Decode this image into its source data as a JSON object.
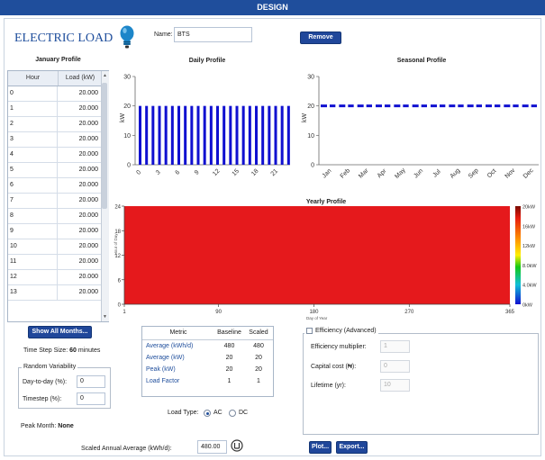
{
  "window": {
    "title": "DESIGN"
  },
  "header": {
    "app_title": "ELECTRIC LOAD",
    "name_label": "Name:",
    "name_value": "BTS",
    "remove_label": "Remove"
  },
  "january_profile": {
    "title": "January Profile",
    "col_hour": "Hour",
    "col_load": "Load (kW)",
    "rows": [
      {
        "hour": "0",
        "load": "20.000"
      },
      {
        "hour": "1",
        "load": "20.000"
      },
      {
        "hour": "2",
        "load": "20.000"
      },
      {
        "hour": "3",
        "load": "20.000"
      },
      {
        "hour": "4",
        "load": "20.000"
      },
      {
        "hour": "5",
        "load": "20.000"
      },
      {
        "hour": "6",
        "load": "20.000"
      },
      {
        "hour": "7",
        "load": "20.000"
      },
      {
        "hour": "8",
        "load": "20.000"
      },
      {
        "hour": "9",
        "load": "20.000"
      },
      {
        "hour": "10",
        "load": "20.000"
      },
      {
        "hour": "11",
        "load": "20.000"
      },
      {
        "hour": "12",
        "load": "20.000"
      },
      {
        "hour": "13",
        "load": "20.000"
      }
    ]
  },
  "show_all_months_label": "Show All Months...",
  "time_step": {
    "label": "Time Step Size:",
    "value": "60",
    "unit": "minutes"
  },
  "random_variability": {
    "title": "Random Variability",
    "day_to_day_label": "Day-to-day (%):",
    "day_to_day_value": "0",
    "timestep_label": "Timestep (%):",
    "timestep_value": "0"
  },
  "peak_month": {
    "label": "Peak Month:",
    "value": "None"
  },
  "scaled_annual": {
    "label": "Scaled Annual Average (kWh/d):",
    "value": "480.00"
  },
  "metrics": {
    "headers": [
      "Metric",
      "Baseline",
      "Scaled"
    ],
    "rows": [
      {
        "metric": "Average (kWh/d)",
        "baseline": "480",
        "scaled": "480"
      },
      {
        "metric": "Average (kW)",
        "baseline": "20",
        "scaled": "20"
      },
      {
        "metric": "Peak (kW)",
        "baseline": "20",
        "scaled": "20"
      },
      {
        "metric": "Load Factor",
        "baseline": "1",
        "scaled": "1"
      }
    ]
  },
  "load_type": {
    "label": "Load Type:",
    "options": [
      "AC",
      "DC"
    ],
    "selected": "AC"
  },
  "efficiency": {
    "title": "Efficiency (Advanced)",
    "checked": false,
    "multiplier_label": "Efficiency multiplier:",
    "multiplier_value": "1",
    "capital_label": "Capital cost (₦):",
    "capital_value": "0",
    "lifetime_label": "Lifetime (yr):",
    "lifetime_value": "10"
  },
  "buttons": {
    "plot": "Plot...",
    "export": "Export..."
  },
  "colors": {
    "accent": "#1f4e9c",
    "bar": "#1010d0",
    "heat": "#e5191c"
  },
  "chart_data": [
    {
      "type": "bar",
      "title": "Daily Profile",
      "ylabel": "kW",
      "ylim": [
        0,
        30
      ],
      "yticks": [
        "0",
        "10",
        "20",
        "30"
      ],
      "x": [
        0,
        1,
        2,
        3,
        4,
        5,
        6,
        7,
        8,
        9,
        10,
        11,
        12,
        13,
        14,
        15,
        16,
        17,
        18,
        19,
        20,
        21,
        22,
        23
      ],
      "xticks": [
        "0",
        "3",
        "6",
        "9",
        "12",
        "15",
        "18",
        "21"
      ],
      "values": [
        20,
        20,
        20,
        20,
        20,
        20,
        20,
        20,
        20,
        20,
        20,
        20,
        20,
        20,
        20,
        20,
        20,
        20,
        20,
        20,
        20,
        20,
        20,
        20
      ]
    },
    {
      "type": "line",
      "title": "Seasonal Profile",
      "ylabel": "kW",
      "ylim": [
        0,
        30
      ],
      "yticks": [
        "0",
        "10",
        "20",
        "30"
      ],
      "categories": [
        "Jan",
        "Feb",
        "Mar",
        "Apr",
        "May",
        "Jun",
        "Jul",
        "Aug",
        "Sep",
        "Oct",
        "Nov",
        "Dec"
      ],
      "values": [
        20,
        20,
        20,
        20,
        20,
        20,
        20,
        20,
        20,
        20,
        20,
        20
      ],
      "line_style": "dashed"
    },
    {
      "type": "heatmap",
      "title": "Yearly Profile",
      "xlabel": "Day of Year",
      "ylabel": "Hour of Day",
      "xlim": [
        1,
        365
      ],
      "ylim": [
        0,
        24
      ],
      "xticks": [
        "1",
        "90",
        "180",
        "270",
        "365"
      ],
      "yticks": [
        "0",
        "6",
        "12",
        "18",
        "24"
      ],
      "value": 20,
      "colorbar": [
        "20kW",
        "16kW",
        "12kW",
        "8.0kW",
        "4.0kW",
        "0kW"
      ]
    }
  ]
}
